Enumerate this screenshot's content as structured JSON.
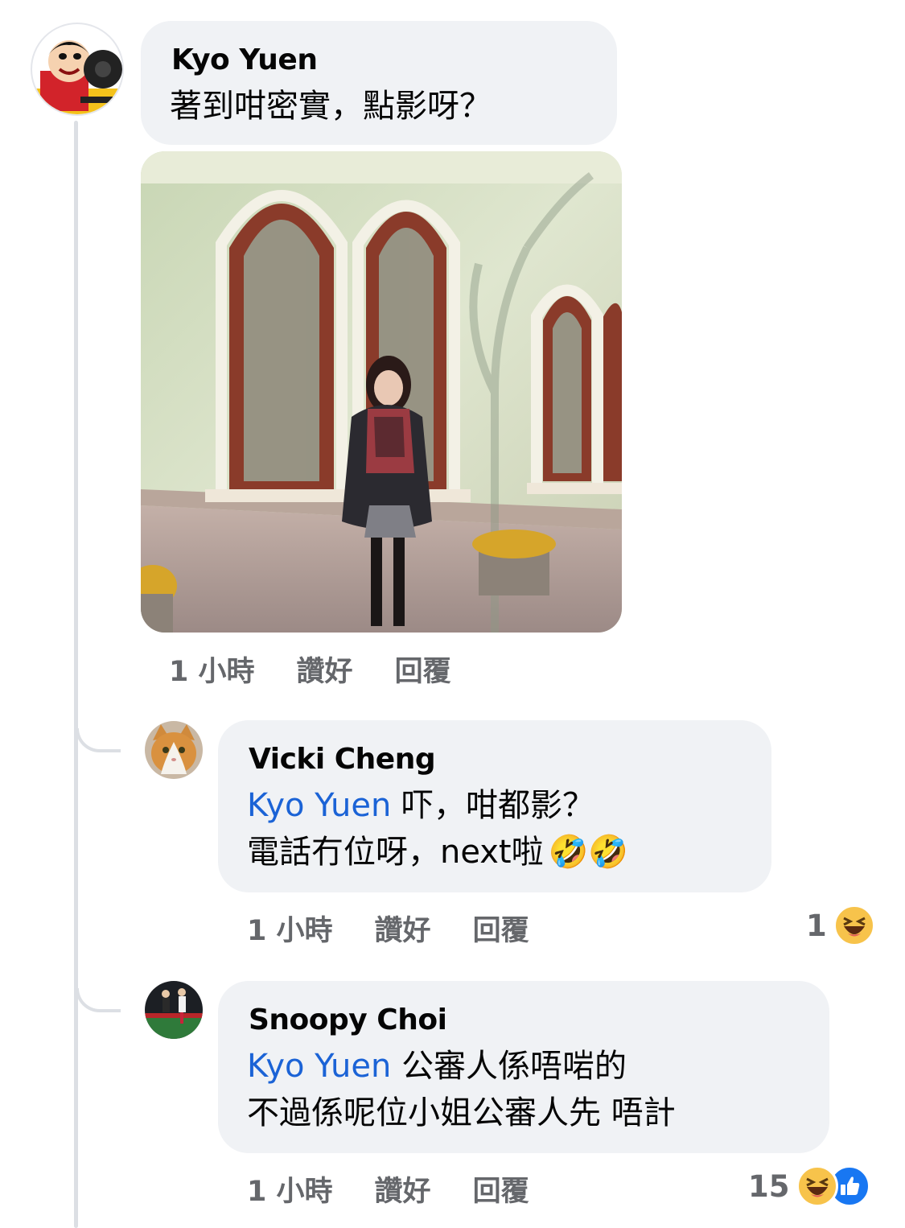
{
  "comments": [
    {
      "author": "Kyo Yuen",
      "text": "著到咁密實，點影呀？",
      "avatar_icon": "cartoon-avatar-icon",
      "time": "1 小時",
      "like": "讚好",
      "reply": "回覆"
    },
    {
      "author": "Vicki Cheng",
      "mention": "Kyo Yuen",
      "line1": "吓，咁都影？",
      "line2": "電話冇位呀，next啦",
      "line2_emoji": "🤣🤣",
      "avatar_icon": "cat-avatar-icon",
      "time": "1 小時",
      "like": "讚好",
      "reply": "回覆",
      "reaction_count": "1",
      "reaction_icons": [
        "haha-icon"
      ]
    },
    {
      "author": "Snoopy Choi",
      "mention": "Kyo Yuen",
      "line1": "公審人係唔啱的",
      "line2": "不過係呢位小姐公審人先 唔計",
      "avatar_icon": "soccer-avatar-icon",
      "time": "1 小時",
      "like": "讚好",
      "reply": "回覆",
      "reaction_count": "15",
      "reaction_icons": [
        "haha-icon",
        "like-icon"
      ]
    }
  ],
  "colors": {
    "bubble": "#f0f2f5",
    "mention": "#1b63d6",
    "meta": "#65676b"
  }
}
